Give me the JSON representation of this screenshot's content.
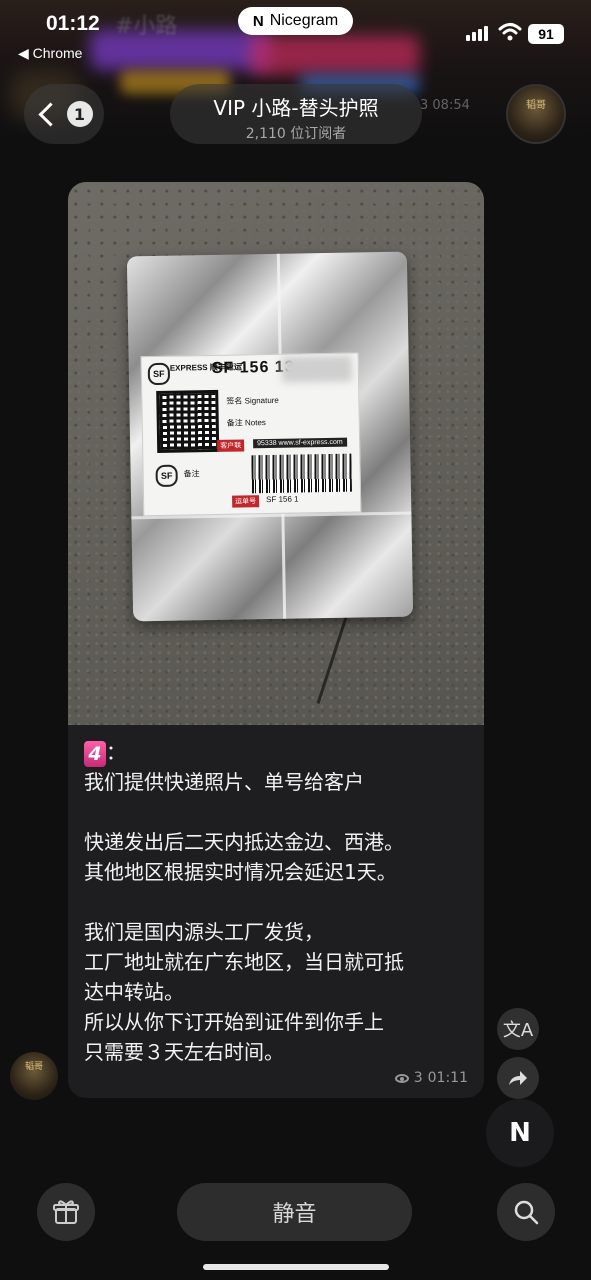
{
  "status_bar": {
    "time": "01:12",
    "back_app": "◀ Chrome",
    "nicegram_label": "Nicegram",
    "battery": "91"
  },
  "pinned_preview": {
    "blur_text": "#小路",
    "time": "3 08:54"
  },
  "header": {
    "unread_count": "1",
    "title": "VIP 小路-替头护照",
    "subtitle": "2,110 位订阅者",
    "avatar_text": "韬哥"
  },
  "message": {
    "number_emoji": "4",
    "lines": [
      "：",
      "我们提供快递照片、单号给客户",
      "快递发出后二天内抵达金边、西港。",
      "其他地区根据实时情况会延迟1天。",
      "我们是国内源头工厂发货，",
      "工厂地址就在广东地区，当日就可抵",
      "达中转站。",
      "所以从你下订开始到证件到你手上",
      "只需要３天左右时间。"
    ],
    "views": "3",
    "time": "01:11"
  },
  "photo_label": {
    "brand": "EXPRESS 顺丰速运",
    "tracking": "SF 156 13",
    "sign": "签名 Signature",
    "note": "备注 Notes",
    "client_tag": "客户联",
    "phone": "95338 www.sf-express.com",
    "note2": "备注",
    "waybill_tag": "运单号",
    "waybill_num": "SF 156 1",
    "logo": "SF"
  },
  "bottom_bar": {
    "mute_label": "静音"
  },
  "colors": {
    "background": "#0f0f10",
    "bubble": "#1e1e20",
    "emoji_pink": "#e0408e"
  }
}
